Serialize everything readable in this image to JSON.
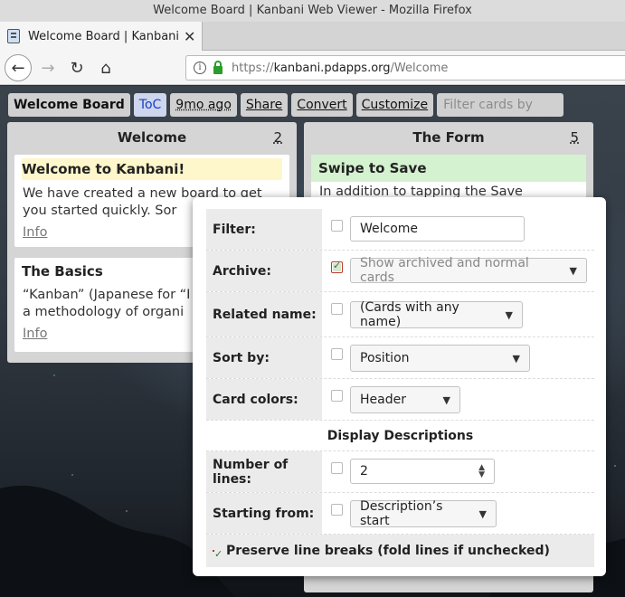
{
  "window": {
    "title": "Welcome Board | Kanbani Web Viewer - Mozilla Firefox"
  },
  "tab": {
    "title": "Welcome Board | Kanbani Web Viewer",
    "close": "✕"
  },
  "nav": {
    "back_icon": "←",
    "forward_icon": "→",
    "reload_icon": "↻",
    "home_icon": "⌂",
    "url_protocol": "https://",
    "url_host": "kanbani.pdapps.org",
    "url_path": "/Welcome"
  },
  "toolbar": {
    "board_title": "Welcome Board",
    "toc": "ToC",
    "age": "9mo ago",
    "share": "Share",
    "convert": "Convert",
    "customize": "Customize",
    "filter_placeholder": "Filter cards by title"
  },
  "columns": [
    {
      "title": "Welcome",
      "count": "2",
      "cards": [
        {
          "title": "Welcome to Kanbani!",
          "desc_line1": "We have created a new board to get",
          "desc_line2": "you started quickly.    Sor",
          "info": "Info"
        },
        {
          "title": "The Basics",
          "desc_line1": "“Kanban” (Japanese for “I",
          "desc_line2": "a methodology of organi",
          "info": "Info"
        }
      ]
    },
    {
      "title": "The Form",
      "count": "5",
      "cards": [
        {
          "title": "Swipe to Save",
          "desc_line1": "In addition to tapping the Save"
        }
      ]
    }
  ],
  "popup": {
    "filter_label": "Filter:",
    "filter_value": "Welcome",
    "archive_label": "Archive:",
    "archive_value": "Show archived and normal cards",
    "related_label": "Related name:",
    "related_value": "(Cards with any name)",
    "sort_label": "Sort by:",
    "sort_value": "Position",
    "colors_label": "Card colors:",
    "colors_value": "Header",
    "section_title": "Display Descriptions",
    "lines_label": "Number of lines:",
    "lines_value": "2",
    "start_label": "Starting from:",
    "start_value": "Description’s start",
    "preserve_label": "Preserve line breaks (fold lines if unchecked)"
  }
}
